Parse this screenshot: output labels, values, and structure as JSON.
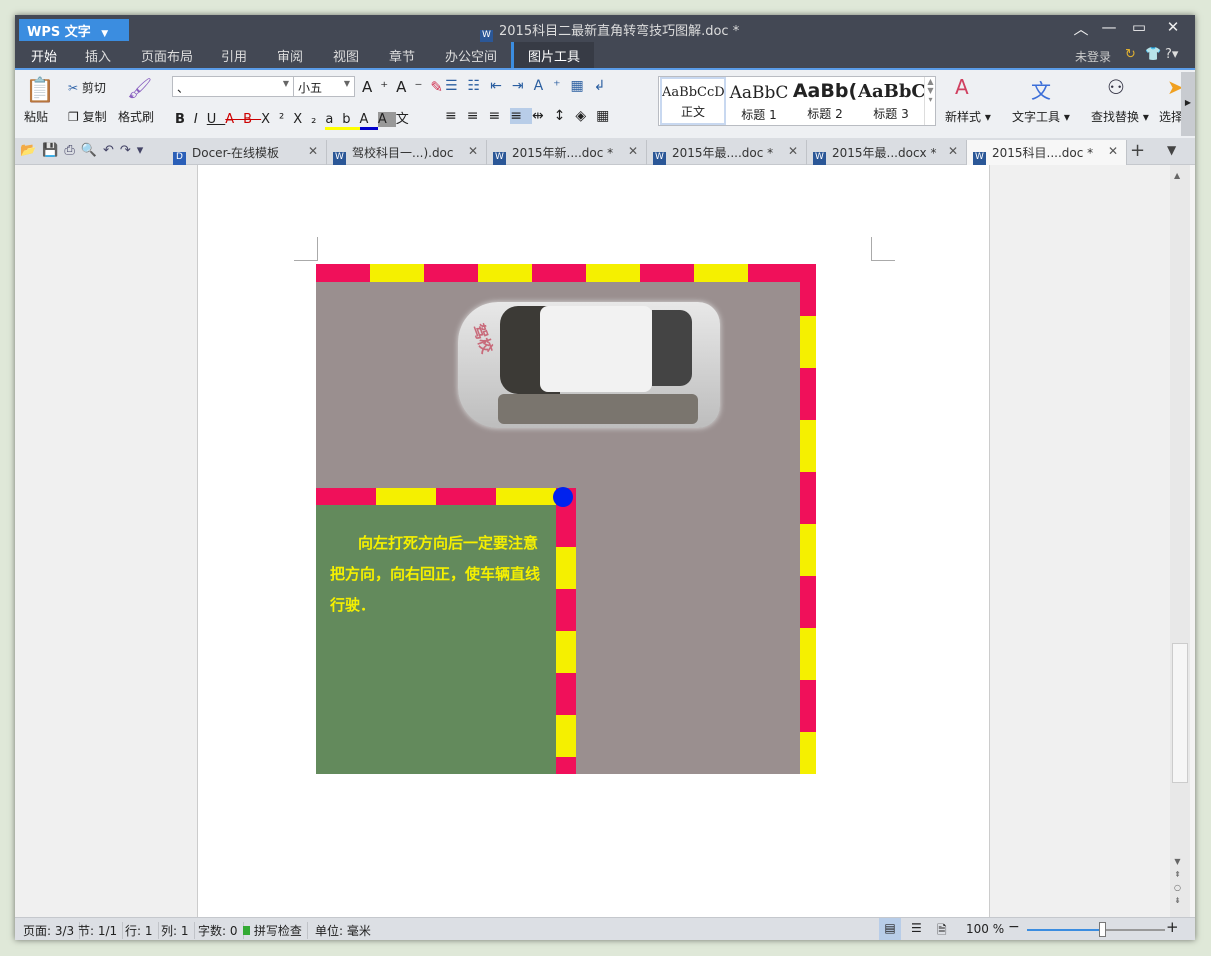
{
  "app": {
    "name": "WPS 文字",
    "doc_title": "2015科目二最新直角转弯技巧图解.doc *"
  },
  "menu": {
    "tabs": [
      "开始",
      "插入",
      "页面布局",
      "引用",
      "审阅",
      "视图",
      "章节",
      "办公空间",
      "图片工具"
    ],
    "login": "未登录"
  },
  "ribbon": {
    "paste": "粘贴",
    "cut": "剪切",
    "copy": "复制",
    "format_painter": "格式刷",
    "font_name": "、",
    "font_size": "小五",
    "styles": [
      {
        "preview": "AaBbCcDc",
        "label": "正文"
      },
      {
        "preview": "AaBbC",
        "label": "标题 1"
      },
      {
        "preview": "AaBb(",
        "label": "标题 2"
      },
      {
        "preview": "AaBbC",
        "label": "标题 3"
      }
    ],
    "new_style": "新样式",
    "text_tools": "文字工具",
    "find_replace": "查找替换",
    "select": "选择"
  },
  "doc_tabs": [
    {
      "label": "Docer-在线模板"
    },
    {
      "label": "驾校科目一...).doc"
    },
    {
      "label": "2015年新....doc *"
    },
    {
      "label": "2015年最....doc *"
    },
    {
      "label": "2015年最...docx *"
    },
    {
      "label": "2015科目....doc *",
      "active": true
    }
  ],
  "document": {
    "caption": "向左打死方向后一定要注意把方向，向右回正，使车辆直线行驶．",
    "car_text": "驾校"
  },
  "colors": {
    "stripe_red": "#f0105a",
    "stripe_yellow": "#f5f000",
    "road": "#9a8f8f",
    "grass": "#638a5c",
    "dot": "#0022ee",
    "accent": "#3b8de0"
  },
  "status": {
    "page": "页面: 3/3",
    "section": "节: 1/1",
    "row": "行: 1",
    "col": "列: 1",
    "words": "字数: 0",
    "spell": "拼写检查",
    "unit": "单位: 毫米",
    "zoom": "100 %",
    "zoom_percent": 100
  }
}
